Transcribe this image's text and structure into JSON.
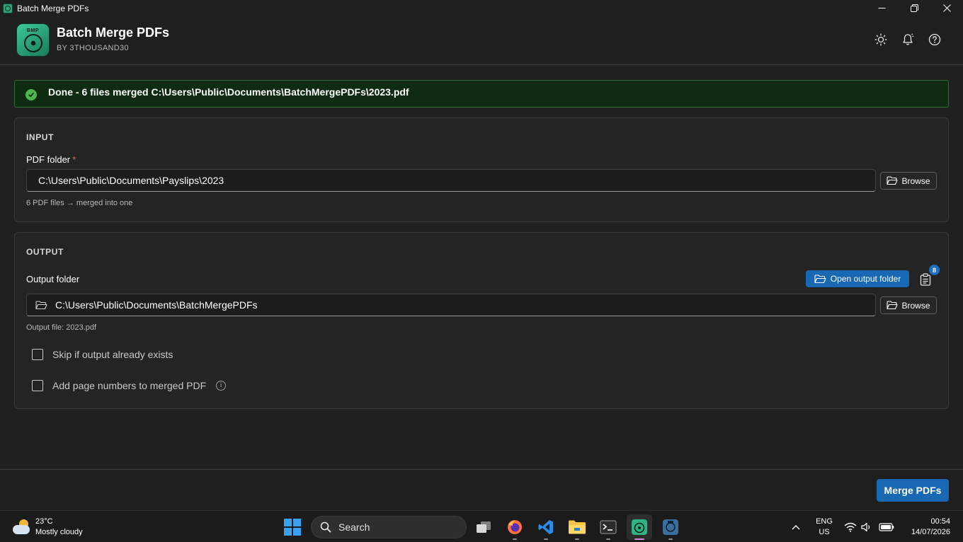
{
  "window": {
    "title": "Batch Merge PDFs"
  },
  "header": {
    "logo_text": "BMP",
    "app_name": "Batch Merge PDFs",
    "by_line": "BY 3THOUSAND30",
    "icons": [
      "sun-icon",
      "bell-icon",
      "help-icon"
    ]
  },
  "banner": {
    "status": "success",
    "message": "Done - 6 files merged C:\\Users\\Public\\Documents\\BatchMergePDFs\\2023.pdf"
  },
  "input": {
    "section_title": "INPUT",
    "folder_label": "PDF folder",
    "required_mark": "*",
    "folder_value": "C:\\Users\\Public\\Documents\\Payslips\\2023",
    "browse_label": "Browse",
    "hint": "6 PDF files → merged into one"
  },
  "output": {
    "section_title": "OUTPUT",
    "folder_label": "Output folder",
    "open_folder_label": "Open output folder",
    "clipboard_badge": "8",
    "folder_value": "C:\\Users\\Public\\Documents\\BatchMergePDFs",
    "browse_label": "Browse",
    "output_file": "Output file: 2023.pdf",
    "options": [
      {
        "label": "Skip if output already exists",
        "checked": false
      },
      {
        "label": "Add page numbers to merged PDF",
        "checked": false,
        "has_info": true
      }
    ]
  },
  "footer": {
    "merge_label": "Merge PDFs"
  },
  "taskbar": {
    "weather_temp": "23°C",
    "weather_desc": "Mostly cloudy",
    "search_label": "Search",
    "apps": [
      "task-view",
      "firefox",
      "vscode",
      "file-explorer",
      "terminal",
      "batch-merge-pdfs",
      "batch-app-2"
    ],
    "lang_top": "ENG",
    "lang_bottom": "US",
    "time": "00:54",
    "date": "14/07/2026"
  },
  "colors": {
    "accent": "#1868b3",
    "success_bg": "#0f2b12",
    "success_border": "#2f6a33",
    "success_icon": "#4fb64f",
    "background": "#202020"
  }
}
